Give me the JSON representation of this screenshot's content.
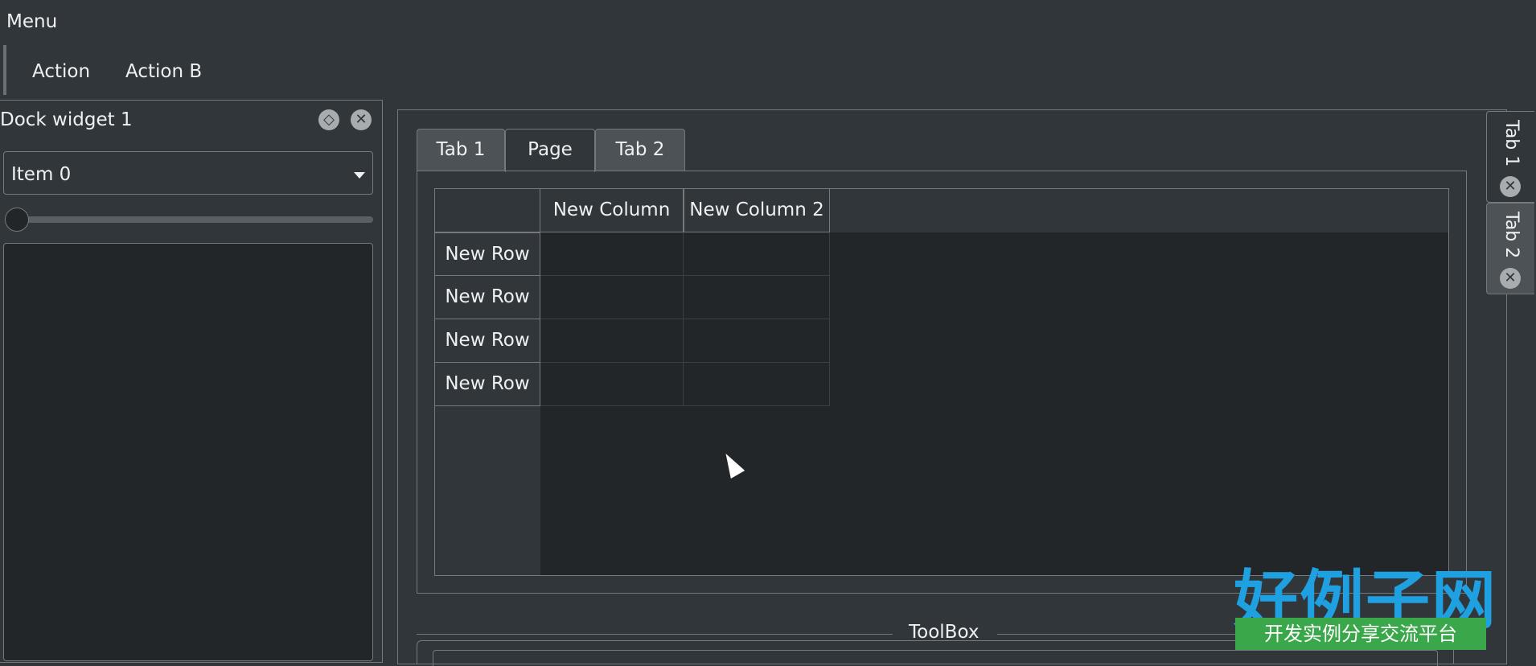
{
  "menubar": {
    "title": "Menu"
  },
  "toolbar": {
    "actions": [
      "Action",
      "Action B"
    ]
  },
  "dock": {
    "title": "Dock widget 1",
    "float_icon": "restore-icon",
    "close_icon": "close-icon",
    "combo_value": "Item 0",
    "slider_value": 0
  },
  "tabs": [
    {
      "label": "Tab 1",
      "active": false
    },
    {
      "label": "Page",
      "active": true
    },
    {
      "label": "Tab 2",
      "active": false
    }
  ],
  "table": {
    "columns": [
      "New Column",
      "New Column 2"
    ],
    "rows": [
      "New Row",
      "New Row",
      "New Row",
      "New Row"
    ]
  },
  "toolbox": {
    "title": "ToolBox"
  },
  "side_tabs": [
    {
      "label": "Tab 1",
      "active": true
    },
    {
      "label": "Tab 2",
      "active": false
    }
  ],
  "watermark": {
    "brand": "好例子网",
    "slogan": "开发实例分享交流平台"
  },
  "colors": {
    "background": "#31363b",
    "view": "#232629",
    "border": "#76797c",
    "text": "#eff0f1"
  }
}
